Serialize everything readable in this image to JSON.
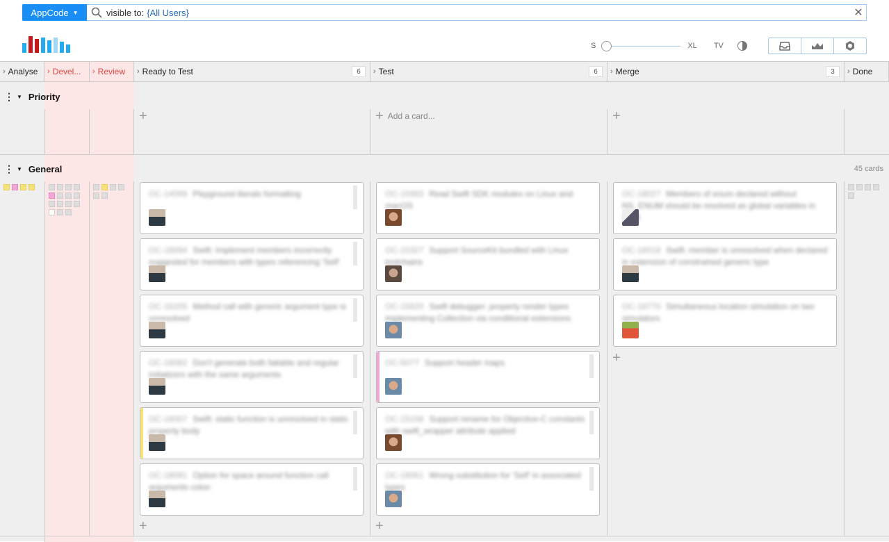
{
  "search": {
    "project": "AppCode",
    "query_prefix": "visible to:",
    "query_value": "{All Users}"
  },
  "controls": {
    "size_small": "S",
    "size_xl": "XL",
    "tv": "TV"
  },
  "columns": [
    {
      "label": "Analyse"
    },
    {
      "label": "Devel..."
    },
    {
      "label": "Review"
    },
    {
      "label": "Ready to Test",
      "count": "6"
    },
    {
      "label": "Test",
      "count": "6"
    },
    {
      "label": "Merge",
      "count": "3"
    },
    {
      "label": "Done"
    }
  ],
  "lanes": {
    "priority": "Priority",
    "general": "General",
    "general_count": "45 cards",
    "add_card": "Add a card..."
  },
  "cards": {
    "ready": [
      {
        "id": "OC-14099",
        "title": "Playground literals formatting"
      },
      {
        "id": "OC-18094",
        "title": "Swift: Implement members incorrectly suggested for members with types referencing 'Self'"
      },
      {
        "id": "OC-16205",
        "title": "Method call with generic argument type is unresolved"
      },
      {
        "id": "OC-18082",
        "title": "Don't generate both failable and regular initializers with the same arguments"
      },
      {
        "id": "OC-16007",
        "title": "Swift: static function is unresolved in static property body"
      },
      {
        "id": "OC-18091",
        "title": "Option for space around function call arguments colon"
      }
    ],
    "test": [
      {
        "id": "OC-15993",
        "title": "Read Swift SDK modules on Linux and macOS"
      },
      {
        "id": "OC-15327",
        "title": "Support SourceKit bundled with Linux toolchains"
      },
      {
        "id": "OC-15820",
        "title": "Swift debugger: property render types implementing Collection via conditional extensions"
      },
      {
        "id": "OC-5077",
        "title": "Support header maps"
      },
      {
        "id": "OC-15158",
        "title": "Support rename for Objective-C constants with swift_wrapper attribute applied"
      },
      {
        "id": "OC-18061",
        "title": "Wrong substitution for 'Self' in associated types"
      }
    ],
    "merge": [
      {
        "id": "OC-18027",
        "title": "Members of enum declared without NS_ENUM should be resolved as global variables in Swift"
      },
      {
        "id": "OC-18018",
        "title": "Swift: member is unresolved when declared in extension of constrained generic type"
      },
      {
        "id": "OC-18770",
        "title": "Simultaneous location simulation on two simulators"
      }
    ]
  },
  "colors": {
    "accent": "#1a8ef5",
    "wip_red": "#e0443f",
    "wip_bg": "#fde6e6",
    "yellow_tag": "#f7e27a",
    "pink_tag": "#f2a8d6"
  }
}
